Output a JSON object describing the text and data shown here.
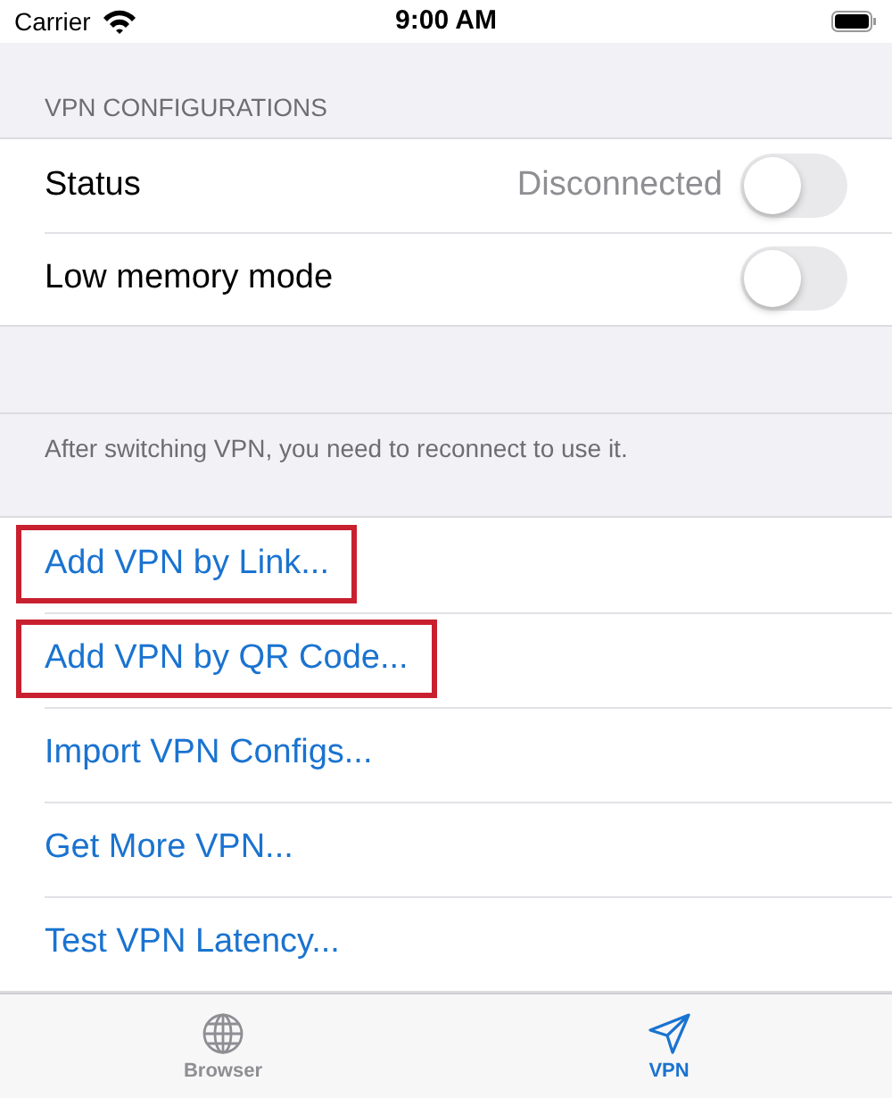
{
  "status_bar": {
    "carrier": "Carrier",
    "time": "9:00 AM"
  },
  "section": {
    "header": "VPN CONFIGURATIONS",
    "rows": [
      {
        "label": "Status",
        "value": "Disconnected",
        "on": false
      },
      {
        "label": "Low memory mode",
        "on": false
      }
    ],
    "footer": "After switching VPN, you need to reconnect to use it."
  },
  "actions": [
    {
      "label": "Add VPN by Link...",
      "highlighted": true
    },
    {
      "label": "Add VPN by QR Code...",
      "highlighted": true
    },
    {
      "label": "Import VPN Configs...",
      "highlighted": false
    },
    {
      "label": "Get More VPN...",
      "highlighted": false
    },
    {
      "label": "Test VPN Latency...",
      "highlighted": false
    }
  ],
  "tabs": [
    {
      "label": "Browser",
      "kind": "globe",
      "selected": false
    },
    {
      "label": "VPN",
      "kind": "send",
      "selected": true
    }
  ]
}
